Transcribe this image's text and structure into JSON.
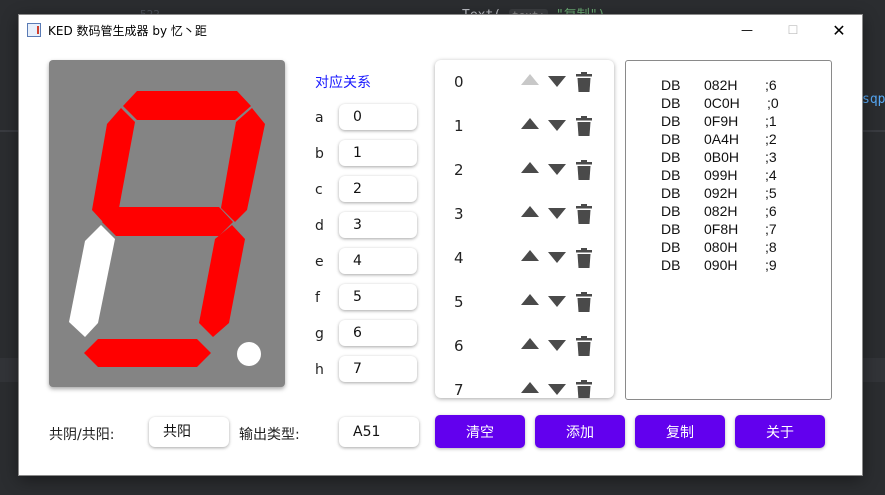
{
  "background_editor": {
    "line_number": "522",
    "code_text": "Text(",
    "param_hint": "text:",
    "code_string": "\"复制\")",
    "side_text": "sqp"
  },
  "window": {
    "title": "KED 数码管生成器 by 忆丶距",
    "minimize": "—",
    "maximize": "☐",
    "close": "✕"
  },
  "display": {
    "segments_on_color": "#ff0000",
    "segments_off_color": "#ffffff",
    "panel_color": "#848484",
    "active_segments": [
      "a",
      "b",
      "c",
      "d",
      "f",
      "g"
    ],
    "inactive_segments": [
      "e"
    ],
    "dot_on": true
  },
  "mapping": {
    "title": "对应关系",
    "rows": [
      {
        "label": "a",
        "value": "0"
      },
      {
        "label": "b",
        "value": "1"
      },
      {
        "label": "c",
        "value": "2"
      },
      {
        "label": "d",
        "value": "3"
      },
      {
        "label": "e",
        "value": "4"
      },
      {
        "label": "f",
        "value": "5"
      },
      {
        "label": "g",
        "value": "6"
      },
      {
        "label": "h",
        "value": "7"
      }
    ]
  },
  "list": {
    "items": [
      {
        "number": "0",
        "up_enabled": false
      },
      {
        "number": "1",
        "up_enabled": true
      },
      {
        "number": "2",
        "up_enabled": true
      },
      {
        "number": "3",
        "up_enabled": true
      },
      {
        "number": "4",
        "up_enabled": true
      },
      {
        "number": "5",
        "up_enabled": true
      },
      {
        "number": "6",
        "up_enabled": true
      },
      {
        "number": "7",
        "up_enabled": true
      }
    ],
    "up_icon": "triangle-up-icon",
    "down_icon": "triangle-down-icon",
    "delete_icon": "trash-icon"
  },
  "output": {
    "lines": [
      {
        "kw": "DB",
        "hex": "082H",
        "comment": ";6"
      },
      {
        "kw": "DB",
        "hex": "0C0H",
        "comment": ";0"
      },
      {
        "kw": "DB",
        "hex": "0F9H",
        "comment": ";1"
      },
      {
        "kw": "DB",
        "hex": "0A4H",
        "comment": ";2"
      },
      {
        "kw": "DB",
        "hex": "0B0H",
        "comment": ";3"
      },
      {
        "kw": "DB",
        "hex": "099H",
        "comment": ";4"
      },
      {
        "kw": "DB",
        "hex": "092H",
        "comment": ";5"
      },
      {
        "kw": "DB",
        "hex": "082H",
        "comment": ";6"
      },
      {
        "kw": "DB",
        "hex": "0F8H",
        "comment": ";7"
      },
      {
        "kw": "DB",
        "hex": "080H",
        "comment": ";8"
      },
      {
        "kw": "DB",
        "hex": "090H",
        "comment": ";9"
      }
    ]
  },
  "bottom": {
    "common_label": "共阴/共阳:",
    "common_value": "共阳",
    "output_type_label": "输出类型:",
    "output_type_value": "A51",
    "buttons": {
      "clear": "清空",
      "add": "添加",
      "copy": "复制",
      "about": "关于"
    },
    "button_color": "#6200ee"
  }
}
